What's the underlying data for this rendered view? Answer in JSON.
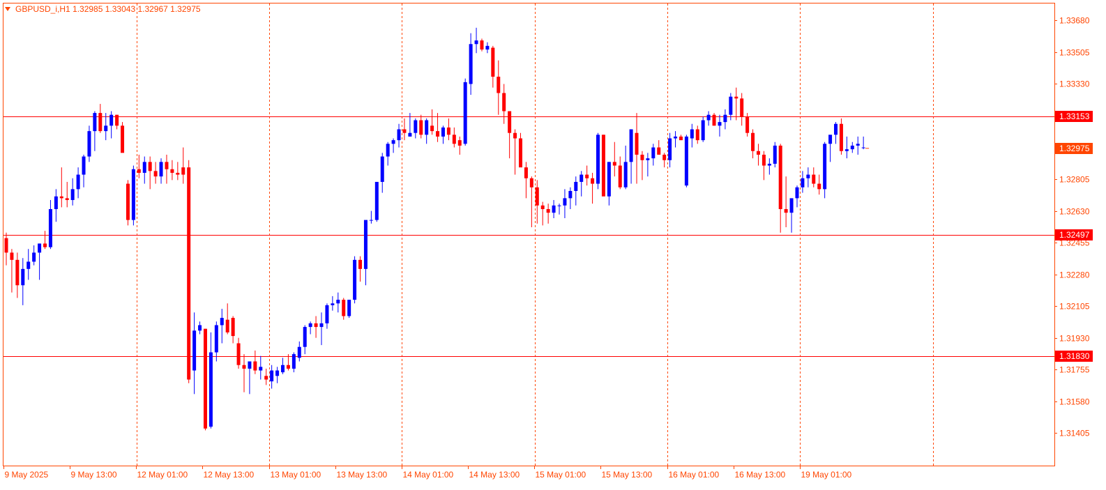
{
  "chart_data": {
    "type": "candlestick",
    "title": "GBPUSD_i,H1  1.32985 1.33043 1.32967 1.32975",
    "symbol": "GBPUSD_i",
    "timeframe": "H1",
    "ohlc_readout": [
      "1.32985",
      "1.33043",
      "1.32967",
      "1.32975"
    ],
    "ylim": [
      1.3131,
      1.3375
    ],
    "y_ticks": [
      "1.33680",
      "1.33505",
      "1.33330",
      "1.32805",
      "1.32630",
      "1.32455",
      "1.32280",
      "1.32105",
      "1.31930",
      "1.31755",
      "1.31580",
      "1.31405"
    ],
    "x_ticks": [
      "9 May 2025",
      "9 May 13:00",
      "12 May 01:00",
      "12 May 13:00",
      "13 May 01:00",
      "13 May 13:00",
      "14 May 01:00",
      "14 May 13:00",
      "15 May 01:00",
      "15 May 13:00",
      "16 May 01:00",
      "16 May 13:00",
      "19 May 01:00"
    ],
    "x_tick_bar_index": [
      0,
      12,
      24,
      36,
      48,
      60,
      72,
      84,
      96,
      108,
      120,
      132,
      144
    ],
    "vertical_grid_bar_index": [
      23,
      47,
      71,
      95,
      119,
      143,
      167
    ],
    "horizontal_levels": [
      {
        "value": 1.33153,
        "label": "1.33153"
      },
      {
        "value": 1.32497,
        "label": "1.32497"
      },
      {
        "value": 1.3183,
        "label": "1.31830"
      }
    ],
    "current_price": {
      "value": 1.32975,
      "label": "1.32975"
    },
    "colors": {
      "bull": "#0000ff",
      "bear": "#ff0000",
      "grid": "#ff4500",
      "axis": "#ff4500",
      "level": "#ff0000",
      "background": "#ffffff"
    },
    "grid": true,
    "candles": [
      [
        1.3248,
        1.3251,
        1.3233,
        1.324
      ],
      [
        1.324,
        1.3242,
        1.3218,
        1.3236
      ],
      [
        1.3236,
        1.324,
        1.3215,
        1.3222
      ],
      [
        1.3222,
        1.3237,
        1.3211,
        1.3231
      ],
      [
        1.3231,
        1.3242,
        1.3225,
        1.3235
      ],
      [
        1.3235,
        1.3244,
        1.3233,
        1.324
      ],
      [
        1.324,
        1.3245,
        1.3225,
        1.3245
      ],
      [
        1.3245,
        1.3252,
        1.3242,
        1.3243
      ],
      [
        1.3243,
        1.3269,
        1.3242,
        1.3264
      ],
      [
        1.3264,
        1.3275,
        1.3257,
        1.3271
      ],
      [
        1.3271,
        1.3287,
        1.3265,
        1.327
      ],
      [
        1.327,
        1.3279,
        1.3265,
        1.3269
      ],
      [
        1.3269,
        1.3281,
        1.3266,
        1.3275
      ],
      [
        1.3275,
        1.3287,
        1.327,
        1.3283
      ],
      [
        1.3283,
        1.3294,
        1.3276,
        1.3293
      ],
      [
        1.3293,
        1.331,
        1.329,
        1.3307
      ],
      [
        1.3307,
        1.3318,
        1.3296,
        1.3317
      ],
      [
        1.3317,
        1.3322,
        1.3306,
        1.3307
      ],
      [
        1.3307,
        1.3317,
        1.3302,
        1.331
      ],
      [
        1.331,
        1.3318,
        1.3303,
        1.3316
      ],
      [
        1.3316,
        1.3316,
        1.3308,
        1.331
      ],
      [
        1.331,
        1.3312,
        1.3296,
        1.3295
      ],
      [
        1.3278,
        1.328,
        1.3255,
        1.3258
      ],
      [
        1.3258,
        1.3288,
        1.3255,
        1.3286
      ],
      [
        1.3286,
        1.3294,
        1.3281,
        1.3284
      ],
      [
        1.3284,
        1.3293,
        1.3278,
        1.329
      ],
      [
        1.329,
        1.3293,
        1.3275,
        1.3285
      ],
      [
        1.3285,
        1.329,
        1.3278,
        1.3282
      ],
      [
        1.3282,
        1.3292,
        1.3278,
        1.329
      ],
      [
        1.329,
        1.3294,
        1.3278,
        1.3286
      ],
      [
        1.3286,
        1.3291,
        1.328,
        1.3284
      ],
      [
        1.3284,
        1.329,
        1.328,
        1.3283
      ],
      [
        1.3287,
        1.3298,
        1.3278,
        1.3283
      ],
      [
        1.3287,
        1.3291,
        1.3168,
        1.317
      ],
      [
        1.3175,
        1.3207,
        1.3162,
        1.3197
      ],
      [
        1.3197,
        1.3202,
        1.3195,
        1.32
      ],
      [
        1.3198,
        1.3198,
        1.3142,
        1.3143
      ],
      [
        1.3144,
        1.3196,
        1.3143,
        1.3185
      ],
      [
        1.3185,
        1.3202,
        1.318,
        1.32
      ],
      [
        1.32,
        1.3209,
        1.319,
        1.3204
      ],
      [
        1.3203,
        1.3212,
        1.3195,
        1.3196
      ],
      [
        1.3204,
        1.3205,
        1.319,
        1.3194
      ],
      [
        1.319,
        1.3193,
        1.3176,
        1.3178
      ],
      [
        1.3178,
        1.3184,
        1.3163,
        1.3176
      ],
      [
        1.3176,
        1.3179,
        1.3162,
        1.318
      ],
      [
        1.318,
        1.3186,
        1.3173,
        1.3175
      ],
      [
        1.3175,
        1.3183,
        1.317,
        1.3177
      ],
      [
        1.3172,
        1.3176,
        1.3167,
        1.317
      ],
      [
        1.3169,
        1.3178,
        1.3165,
        1.3175
      ],
      [
        1.3172,
        1.3177,
        1.3168,
        1.3175
      ],
      [
        1.3174,
        1.3182,
        1.3173,
        1.3178
      ],
      [
        1.3178,
        1.3184,
        1.3175,
        1.3176
      ],
      [
        1.3176,
        1.3185,
        1.3174,
        1.3184
      ],
      [
        1.3182,
        1.3191,
        1.318,
        1.3188
      ],
      [
        1.3188,
        1.32,
        1.3184,
        1.3199
      ],
      [
        1.3199,
        1.3202,
        1.3195,
        1.3201
      ],
      [
        1.3201,
        1.3205,
        1.3193,
        1.3199
      ],
      [
        1.3199,
        1.3207,
        1.3189,
        1.3201
      ],
      [
        1.3201,
        1.3212,
        1.3198,
        1.3211
      ],
      [
        1.3211,
        1.3216,
        1.3208,
        1.3212
      ],
      [
        1.3212,
        1.3218,
        1.3207,
        1.3214
      ],
      [
        1.3214,
        1.3215,
        1.3203,
        1.3205
      ],
      [
        1.3205,
        1.3212,
        1.3204,
        1.3214
      ],
      [
        1.3214,
        1.3238,
        1.3212,
        1.3236
      ],
      [
        1.3236,
        1.3238,
        1.3224,
        1.3231
      ],
      [
        1.3231,
        1.3252,
        1.3222,
        1.3258
      ],
      [
        1.3258,
        1.3263,
        1.3256,
        1.3258
      ],
      [
        1.3258,
        1.3279,
        1.3257,
        1.3279
      ],
      [
        1.3279,
        1.3295,
        1.3273,
        1.3293
      ],
      [
        1.3293,
        1.3301,
        1.3288,
        1.33
      ],
      [
        1.33,
        1.3303,
        1.3295,
        1.3302
      ],
      [
        1.3302,
        1.3311,
        1.3298,
        1.3308
      ],
      [
        1.3308,
        1.3314,
        1.3302,
        1.3306
      ],
      [
        1.3304,
        1.3317,
        1.3304,
        1.3306
      ],
      [
        1.3306,
        1.3314,
        1.3303,
        1.3313
      ],
      [
        1.3313,
        1.3316,
        1.3303,
        1.3305
      ],
      [
        1.3305,
        1.3314,
        1.33,
        1.3313
      ],
      [
        1.331,
        1.3319,
        1.3305,
        1.3307
      ],
      [
        1.3307,
        1.3317,
        1.3301,
        1.3304
      ],
      [
        1.3304,
        1.331,
        1.33,
        1.3309
      ],
      [
        1.3309,
        1.3314,
        1.3302,
        1.3305
      ],
      [
        1.3305,
        1.3309,
        1.3298,
        1.33
      ],
      [
        1.3302,
        1.3304,
        1.3294,
        1.3299
      ],
      [
        1.33,
        1.3336,
        1.3299,
        1.3334
      ],
      [
        1.3333,
        1.3361,
        1.3327,
        1.3355
      ],
      [
        1.3355,
        1.3364,
        1.335,
        1.3357
      ],
      [
        1.3357,
        1.3358,
        1.3351,
        1.3352
      ],
      [
        1.3352,
        1.3356,
        1.335,
        1.3354
      ],
      [
        1.3353,
        1.3354,
        1.3331,
        1.3337
      ],
      [
        1.3337,
        1.3346,
        1.3316,
        1.3328
      ],
      [
        1.3328,
        1.3333,
        1.3311,
        1.3318
      ],
      [
        1.3318,
        1.3317,
        1.3292,
        1.3306
      ],
      [
        1.3306,
        1.3308,
        1.3283,
        1.3303
      ],
      [
        1.3303,
        1.3306,
        1.3289,
        1.3287
      ],
      [
        1.3287,
        1.329,
        1.327,
        1.3281
      ],
      [
        1.3281,
        1.3282,
        1.3254,
        1.3276
      ],
      [
        1.3276,
        1.328,
        1.3256,
        1.3266
      ],
      [
        1.3266,
        1.3268,
        1.3255,
        1.3264
      ],
      [
        1.3264,
        1.3267,
        1.3256,
        1.3262
      ],
      [
        1.3262,
        1.3269,
        1.3259,
        1.3266
      ],
      [
        1.3266,
        1.3267,
        1.3261,
        1.3266
      ],
      [
        1.3266,
        1.3275,
        1.3259,
        1.327
      ],
      [
        1.327,
        1.3276,
        1.3264,
        1.3274
      ],
      [
        1.3274,
        1.3282,
        1.3266,
        1.3279
      ],
      [
        1.3279,
        1.3285,
        1.3271,
        1.3283
      ],
      [
        1.3283,
        1.3288,
        1.3277,
        1.3281
      ],
      [
        1.3281,
        1.3284,
        1.3267,
        1.3278
      ],
      [
        1.3278,
        1.3306,
        1.3275,
        1.3305
      ],
      [
        1.3305,
        1.3305,
        1.3273,
        1.3271
      ],
      [
        1.3271,
        1.329,
        1.3266,
        1.329
      ],
      [
        1.329,
        1.3301,
        1.3282,
        1.3288
      ],
      [
        1.3288,
        1.3293,
        1.3275,
        1.3276
      ],
      [
        1.3276,
        1.3299,
        1.3275,
        1.329
      ],
      [
        1.329,
        1.3308,
        1.3278,
        1.3308
      ],
      [
        1.3306,
        1.3317,
        1.3278,
        1.3294
      ],
      [
        1.3294,
        1.3296,
        1.328,
        1.3291
      ],
      [
        1.3291,
        1.3295,
        1.3282,
        1.3292
      ],
      [
        1.3292,
        1.33,
        1.3288,
        1.3298
      ],
      [
        1.3298,
        1.3302,
        1.3294,
        1.3294
      ],
      [
        1.3294,
        1.3295,
        1.3287,
        1.3291
      ],
      [
        1.3291,
        1.3306,
        1.3287,
        1.3303
      ],
      [
        1.3303,
        1.3307,
        1.3298,
        1.3304
      ],
      [
        1.3304,
        1.3305,
        1.3302,
        1.3302
      ],
      [
        1.3277,
        1.3305,
        1.3276,
        1.3304
      ],
      [
        1.3303,
        1.3311,
        1.3298,
        1.3308
      ],
      [
        1.3308,
        1.331,
        1.33,
        1.3302
      ],
      [
        1.3302,
        1.3315,
        1.3301,
        1.3313
      ],
      [
        1.3313,
        1.3318,
        1.331,
        1.3316
      ],
      [
        1.3316,
        1.3317,
        1.331,
        1.331
      ],
      [
        1.331,
        1.3316,
        1.3304,
        1.3312
      ],
      [
        1.3312,
        1.3319,
        1.3308,
        1.3316
      ],
      [
        1.3316,
        1.3328,
        1.3313,
        1.3326
      ],
      [
        1.3326,
        1.3331,
        1.3313,
        1.3325
      ],
      [
        1.3325,
        1.3328,
        1.331,
        1.3315
      ],
      [
        1.3315,
        1.3317,
        1.3304,
        1.3306
      ],
      [
        1.3306,
        1.3308,
        1.3292,
        1.3296
      ],
      [
        1.3296,
        1.33,
        1.3288,
        1.3294
      ],
      [
        1.3294,
        1.3296,
        1.328,
        1.3288
      ],
      [
        1.3288,
        1.3292,
        1.3283,
        1.3289
      ],
      [
        1.3289,
        1.3301,
        1.3287,
        1.3299
      ],
      [
        1.3299,
        1.33,
        1.3251,
        1.3264
      ],
      [
        1.3264,
        1.3282,
        1.3254,
        1.3262
      ],
      [
        1.3262,
        1.3264,
        1.3251,
        1.327
      ],
      [
        1.327,
        1.3277,
        1.3265,
        1.3276
      ],
      [
        1.3276,
        1.3285,
        1.3273,
        1.3281
      ],
      [
        1.3281,
        1.3287,
        1.3276,
        1.3283
      ],
      [
        1.3283,
        1.3287,
        1.3276,
        1.3278
      ],
      [
        1.3278,
        1.3283,
        1.3272,
        1.3275
      ],
      [
        1.3275,
        1.3301,
        1.327,
        1.33
      ],
      [
        1.33,
        1.3303,
        1.329,
        1.3305
      ],
      [
        1.3305,
        1.3312,
        1.33,
        1.3311
      ],
      [
        1.3311,
        1.3314,
        1.3294,
        1.3296
      ],
      [
        1.3296,
        1.3304,
        1.3292,
        1.3297
      ],
      [
        1.3297,
        1.3301,
        1.3295,
        1.3299
      ],
      [
        1.3299,
        1.3304,
        1.3294,
        1.33
      ],
      [
        1.3298,
        1.3304,
        1.3297,
        1.3298
      ]
    ]
  }
}
